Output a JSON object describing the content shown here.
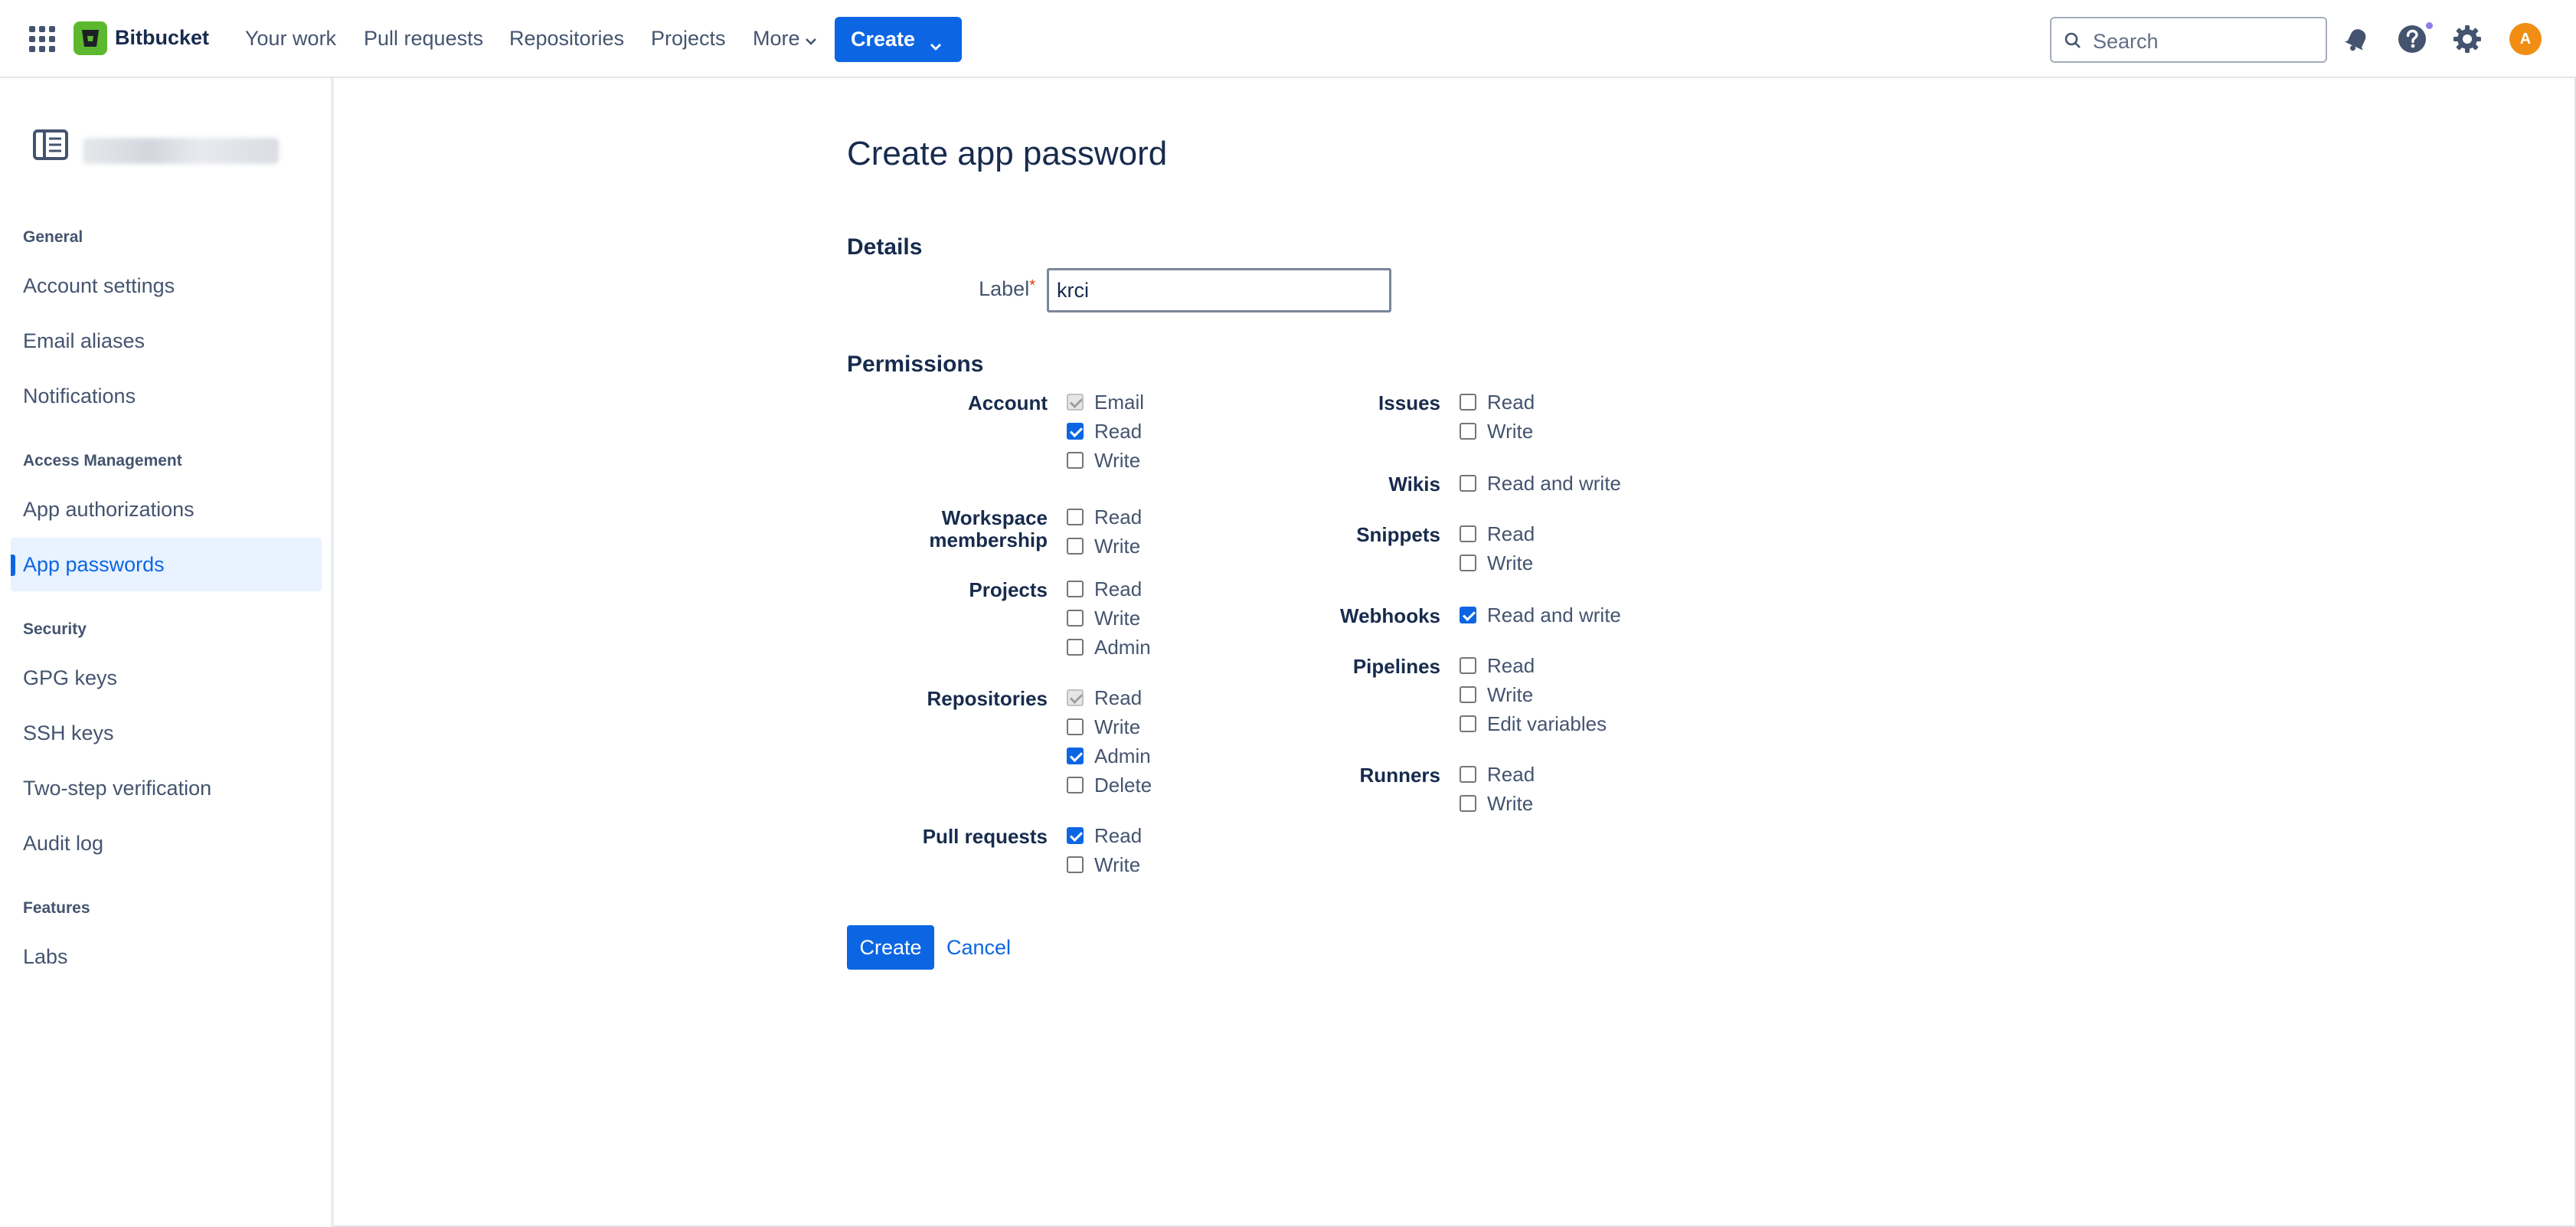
{
  "topnav": {
    "brand": "Bitbucket",
    "items": [
      "Your work",
      "Pull requests",
      "Repositories",
      "Projects",
      "More"
    ],
    "create_label": "Create",
    "search_placeholder": "Search",
    "avatar_initial": "A",
    "icons": [
      "app-switcher-icon",
      "bitbucket-logo-icon",
      "notifications-icon",
      "help-icon",
      "settings-icon"
    ]
  },
  "sidebar": {
    "sections": [
      {
        "title": "General",
        "items": [
          "Account settings",
          "Email aliases",
          "Notifications"
        ]
      },
      {
        "title": "Access Management",
        "items": [
          "App authorizations",
          "App passwords"
        ]
      },
      {
        "title": "Security",
        "items": [
          "GPG keys",
          "SSH keys",
          "Two-step verification",
          "Audit log"
        ]
      },
      {
        "title": "Features",
        "items": [
          "Labs"
        ]
      }
    ],
    "active_item": "App passwords"
  },
  "main": {
    "title": "Create app password",
    "details_heading": "Details",
    "label_field": {
      "label": "Label",
      "required_marker": "*",
      "value": "krci"
    },
    "permissions_heading": "Permissions",
    "permissions_left": [
      {
        "group": "Account",
        "options": [
          {
            "label": "Email",
            "checked": true,
            "disabled": true
          },
          {
            "label": "Read",
            "checked": true
          },
          {
            "label": "Write",
            "checked": false
          }
        ]
      },
      {
        "group": "Workspace\nmembership",
        "options": [
          {
            "label": "Read",
            "checked": false
          },
          {
            "label": "Write",
            "checked": false
          }
        ]
      },
      {
        "group": "Projects",
        "options": [
          {
            "label": "Read",
            "checked": false
          },
          {
            "label": "Write",
            "checked": false
          },
          {
            "label": "Admin",
            "checked": false
          }
        ]
      },
      {
        "group": "Repositories",
        "options": [
          {
            "label": "Read",
            "checked": true,
            "disabled": true
          },
          {
            "label": "Write",
            "checked": false
          },
          {
            "label": "Admin",
            "checked": true
          },
          {
            "label": "Delete",
            "checked": false
          }
        ]
      },
      {
        "group": "Pull requests",
        "options": [
          {
            "label": "Read",
            "checked": true
          },
          {
            "label": "Write",
            "checked": false
          }
        ]
      }
    ],
    "permissions_right": [
      {
        "group": "Issues",
        "options": [
          {
            "label": "Read",
            "checked": false
          },
          {
            "label": "Write",
            "checked": false
          }
        ]
      },
      {
        "group": "Wikis",
        "options": [
          {
            "label": "Read and write",
            "checked": false
          }
        ]
      },
      {
        "group": "Snippets",
        "options": [
          {
            "label": "Read",
            "checked": false
          },
          {
            "label": "Write",
            "checked": false
          }
        ]
      },
      {
        "group": "Webhooks",
        "options": [
          {
            "label": "Read and write",
            "checked": true
          }
        ]
      },
      {
        "group": "Pipelines",
        "options": [
          {
            "label": "Read",
            "checked": false
          },
          {
            "label": "Write",
            "checked": false
          },
          {
            "label": "Edit variables",
            "checked": false
          }
        ]
      },
      {
        "group": "Runners",
        "options": [
          {
            "label": "Read",
            "checked": false
          },
          {
            "label": "Write",
            "checked": false
          }
        ]
      }
    ],
    "create_button": "Create",
    "cancel_link": "Cancel"
  },
  "colors": {
    "accent": "#0c66e4",
    "brand": "#5cb82e",
    "avatar": "#f18d13"
  }
}
